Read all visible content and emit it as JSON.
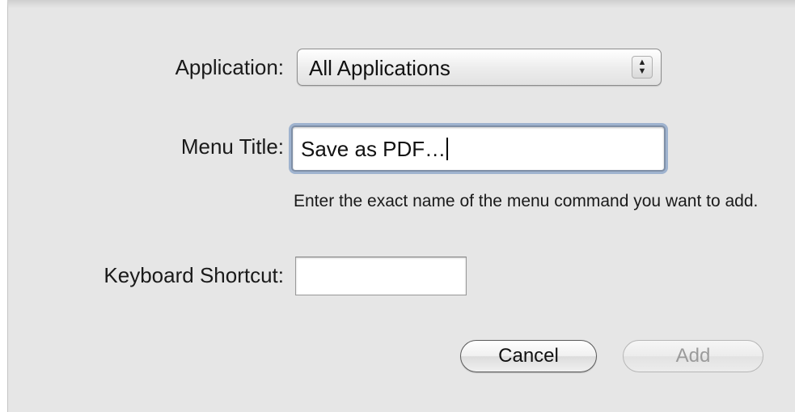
{
  "dialog": {
    "application": {
      "label": "Application:",
      "selected_value": "All Applications",
      "arrows_icon": "popup-up-down-arrows-icon"
    },
    "menu_title": {
      "label": "Menu Title:",
      "value": "Save as PDF…",
      "help_text": "Enter the exact name of the menu command you want to add."
    },
    "keyboard_shortcut": {
      "label": "Keyboard Shortcut:",
      "value": ""
    },
    "buttons": {
      "cancel_label": "Cancel",
      "add_label": "Add"
    }
  },
  "colors": {
    "sheet_background": "#e6e6e6",
    "focus_ring": "#9fb3cf",
    "disabled_text": "#9b9b9b"
  }
}
